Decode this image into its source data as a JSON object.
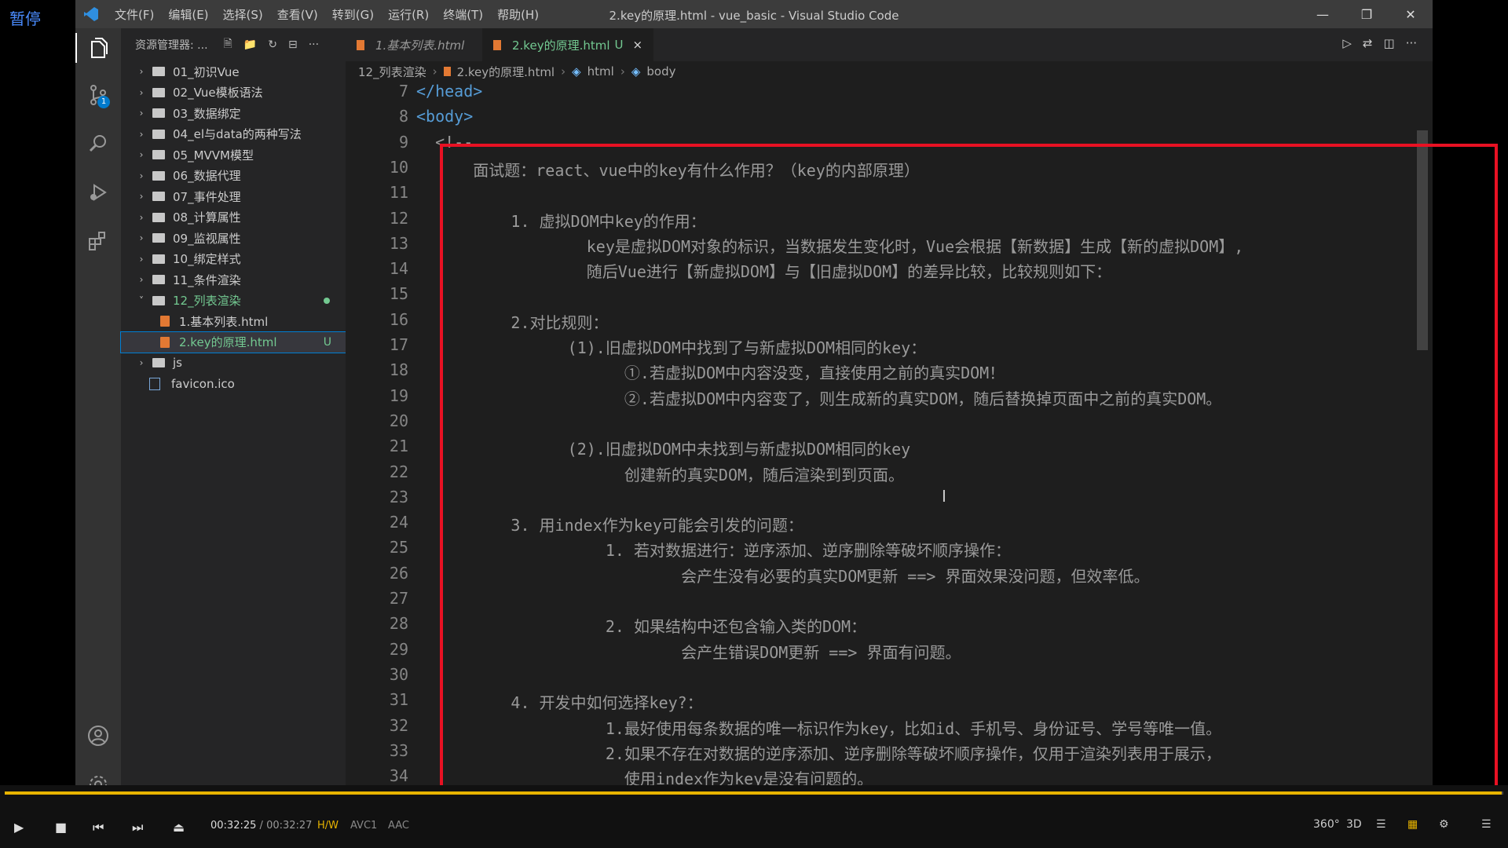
{
  "player": {
    "pause_label": "暂停",
    "progress": 0.999,
    "time_current": "00:32:25",
    "time_separator": "/",
    "time_total": "00:32:27",
    "badges": [
      "H/W",
      "AVC1",
      "AAC"
    ],
    "right_labels": {
      "r360": "360°",
      "r3d": "3D"
    }
  },
  "vscode": {
    "menu": [
      "文件(F)",
      "编辑(E)",
      "选择(S)",
      "查看(V)",
      "转到(G)",
      "运行(R)",
      "终端(T)",
      "帮助(H)"
    ],
    "window_title": "2.key的原理.html - vue_basic - Visual Studio Code",
    "scm_badge": "1",
    "explorer_title": "资源管理器: ...",
    "tree": [
      {
        "label": "01_初识Vue",
        "type": "folder"
      },
      {
        "label": "02_Vue模板语法",
        "type": "folder"
      },
      {
        "label": "03_数据绑定",
        "type": "folder"
      },
      {
        "label": "04_el与data的两种写法",
        "type": "folder"
      },
      {
        "label": "05_MVVM模型",
        "type": "folder"
      },
      {
        "label": "06_数据代理",
        "type": "folder"
      },
      {
        "label": "07_事件处理",
        "type": "folder"
      },
      {
        "label": "08_计算属性",
        "type": "folder"
      },
      {
        "label": "09_监视属性",
        "type": "folder"
      },
      {
        "label": "10_绑定样式",
        "type": "folder"
      },
      {
        "label": "11_条件渲染",
        "type": "folder"
      },
      {
        "label": "12_列表渲染",
        "type": "folder-open"
      },
      {
        "label": "1.基本列表.html",
        "type": "file"
      },
      {
        "label": "2.key的原理.html",
        "type": "file-selected",
        "status": "U"
      },
      {
        "label": "js",
        "type": "folder"
      },
      {
        "label": "favicon.ico",
        "type": "ico"
      }
    ],
    "tabs": [
      {
        "label": "1.基本列表.html"
      },
      {
        "label": "2.key的原理.html",
        "status": "U",
        "close": "×"
      }
    ],
    "breadcrumb": [
      "12_列表渲染",
      "2.key的原理.html",
      "html",
      "body"
    ],
    "line_numbers": [
      "7",
      "8",
      "9",
      "10",
      "11",
      "12",
      "13",
      "14",
      "15",
      "16",
      "17",
      "18",
      "19",
      "20",
      "21",
      "22",
      "23",
      "24",
      "25",
      "26",
      "27",
      "28",
      "29",
      "30",
      "31",
      "32",
      "33",
      "34"
    ],
    "code_lines": [
      "</head>",
      "<body>",
      "  <!--",
      "      面试题：react、vue中的key有什么作用？（key的内部原理）",
      "",
      "          1. 虚拟DOM中key的作用：",
      "                  key是虚拟DOM对象的标识，当数据发生变化时，Vue会根据【新数据】生成【新的虚拟DOM】,",
      "                  随后Vue进行【新虚拟DOM】与【旧虚拟DOM】的差异比较，比较规则如下：",
      "",
      "          2.对比规则：",
      "                (1).旧虚拟DOM中找到了与新虚拟DOM相同的key：",
      "                      ①.若虚拟DOM中内容没变，直接使用之前的真实DOM！",
      "                      ②.若虚拟DOM中内容变了，则生成新的真实DOM，随后替换掉页面中之前的真实DOM。",
      "",
      "                (2).旧虚拟DOM中未找到与新虚拟DOM相同的key",
      "                      创建新的真实DOM，随后渲染到到页面。",
      "",
      "          3. 用index作为key可能会引发的问题：",
      "                    1. 若对数据进行：逆序添加、逆序删除等破坏顺序操作：",
      "                            会产生没有必要的真实DOM更新 ==> 界面效果没问题，但效率低。",
      "",
      "                    2. 如果结构中还包含输入类的DOM：",
      "                            会产生错误DOM更新 ==> 界面有问题。",
      "",
      "          4. 开发中如何选择key?：",
      "                    1.最好使用每条数据的唯一标识作为key，比如id、手机号、身份证号、学号等唯一值。",
      "                    2.如果不存在对数据的逆序添加、逆序删除等破坏顺序操作，仅用于渲染列表用于展示，",
      "                      使用index作为key是没有问题的。"
    ]
  },
  "colors": {
    "accent_blue": "#007acc",
    "highlight_red": "#e81123",
    "git_green": "#73c991",
    "progress_yellow": "#e8b400"
  }
}
